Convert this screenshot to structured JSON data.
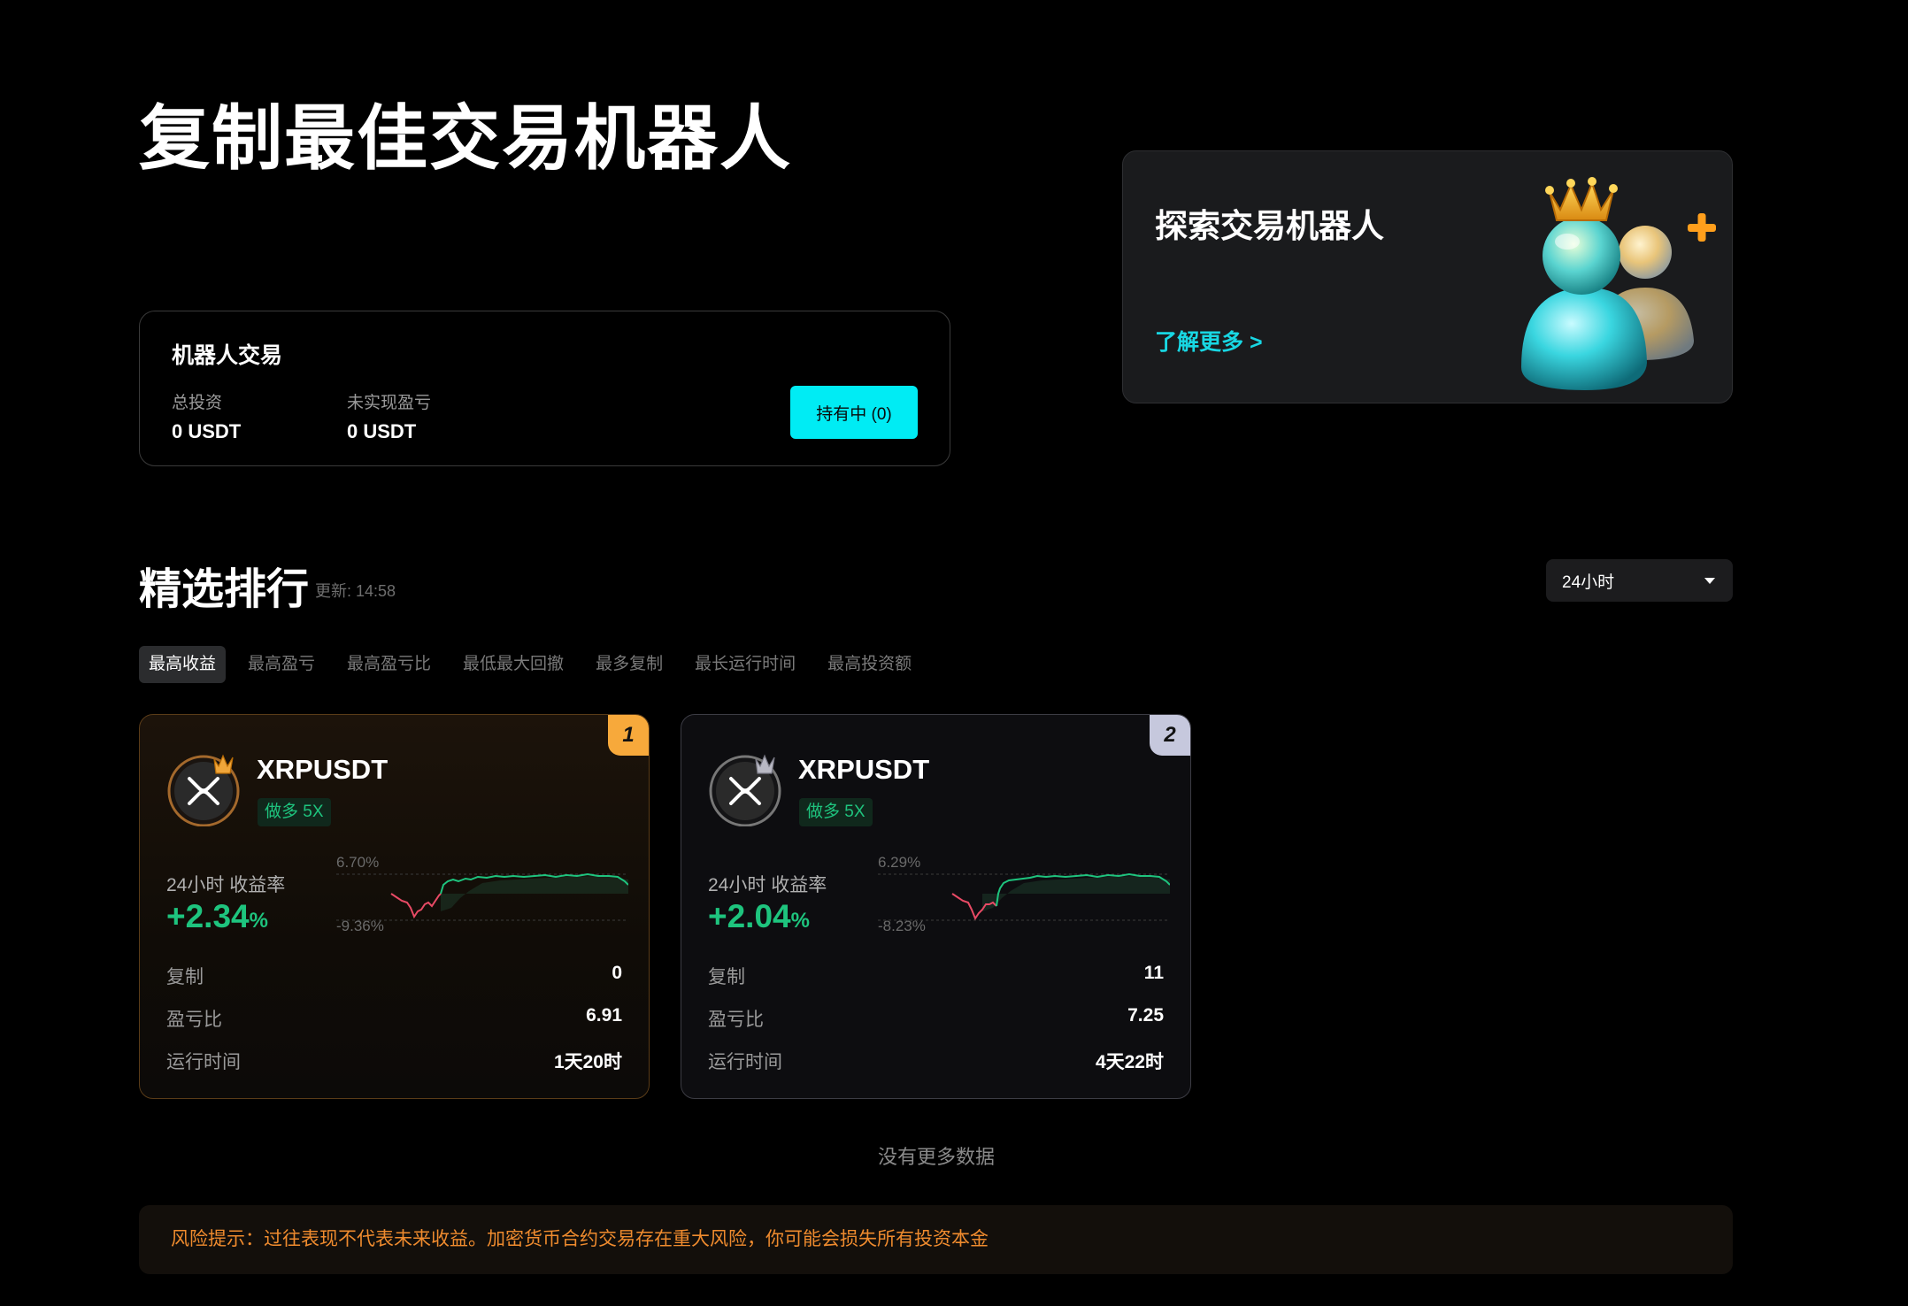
{
  "hero": {
    "title": "复制最佳交易机器人"
  },
  "robot_trading": {
    "title": "机器人交易",
    "total_investment_label": "总投资",
    "total_investment_value": "0 USDT",
    "unrealized_pnl_label": "未实现盈亏",
    "unrealized_pnl_value": "0 USDT",
    "holding_button": "持有中 (0)"
  },
  "explore": {
    "title": "探索交易机器人",
    "learn_more": "了解更多 >"
  },
  "ranking": {
    "title": "精选排行",
    "update_time": "更新: 14:58",
    "period": "24小时",
    "tabs": [
      "最高收益",
      "最高盈亏",
      "最高盈亏比",
      "最低最大回撤",
      "最多复制",
      "最长运行时间",
      "最高投资额"
    ]
  },
  "bots": [
    {
      "rank": "1",
      "pair": "XRPUSDT",
      "tag": "做多 5X",
      "yield_label": "24小时 收益率",
      "yield_value": "+2.34",
      "yield_unit": "%",
      "chart_max": "6.70%",
      "chart_min": "-9.36%",
      "copy_label": "复制",
      "copy_value": "0",
      "pl_ratio_label": "盈亏比",
      "pl_ratio_value": "6.91",
      "runtime_label": "运行时间",
      "runtime_value": "1天20时"
    },
    {
      "rank": "2",
      "pair": "XRPUSDT",
      "tag": "做多 5X",
      "yield_label": "24小时 收益率",
      "yield_value": "+2.04",
      "yield_unit": "%",
      "chart_max": "6.29%",
      "chart_min": "-8.23%",
      "copy_label": "复制",
      "copy_value": "11",
      "pl_ratio_label": "盈亏比",
      "pl_ratio_value": "7.25",
      "runtime_label": "运行时间",
      "runtime_value": "4天22时"
    }
  ],
  "no_more": "没有更多数据",
  "risk_notice": "风险提示：过往表现不代表未来收益。加密货币合约交易存在重大风险，你可能会损失所有投资本金",
  "colors": {
    "accent": "#00ecf4",
    "positive": "#1ec47e",
    "negative": "#e84a65",
    "warning": "#ef8b2e"
  },
  "icons": {
    "coin": "xrp-icon",
    "rank1_crown": "gold-crown-icon",
    "rank2_crown": "silver-crown-icon"
  }
}
